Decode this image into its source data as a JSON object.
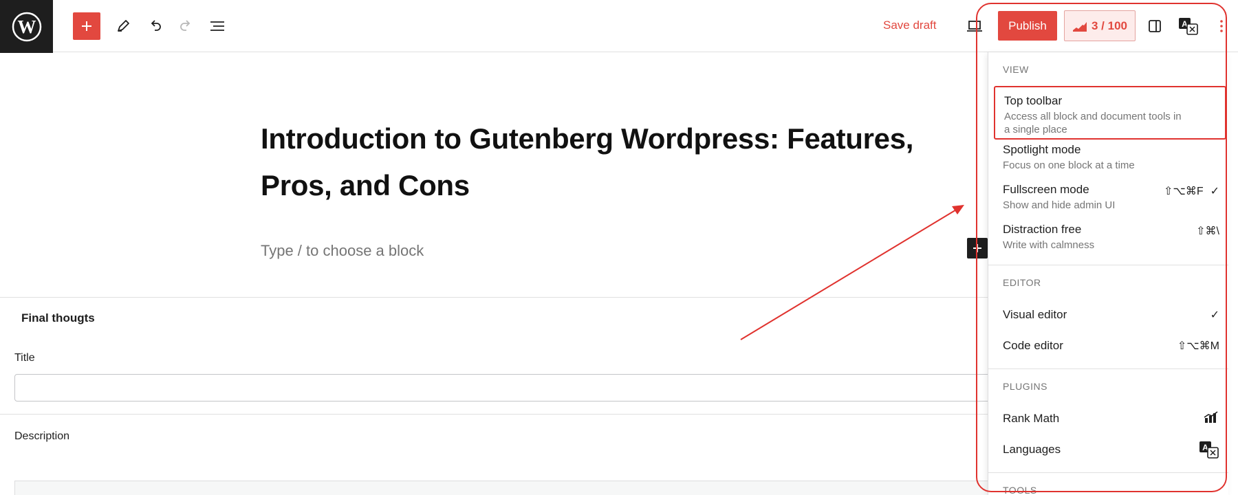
{
  "header": {
    "save_draft": "Save draft",
    "publish": "Publish",
    "seo_score": "3 / 100"
  },
  "editor": {
    "post_title": "Introduction to Gutenberg Wordpress: Features, Pros, and Cons",
    "block_placeholder": "Type / to choose a block"
  },
  "meta_box": {
    "heading": "Final thougts",
    "title_label": "Title",
    "description_label": "Description"
  },
  "menu": {
    "view_title": "VIEW",
    "top_toolbar_label": "Top toolbar",
    "top_toolbar_desc": "Access all block and document tools in a single place",
    "spotlight_label": "Spotlight mode",
    "spotlight_desc": "Focus on one block at a time",
    "fullscreen_label": "Fullscreen mode",
    "fullscreen_desc": "Show and hide admin UI",
    "fullscreen_shortcut": "⇧⌥⌘F",
    "distraction_label": "Distraction free",
    "distraction_desc": "Write with calmness",
    "distraction_shortcut": "⇧⌘\\",
    "editor_title": "EDITOR",
    "visual_editor": "Visual editor",
    "code_editor": "Code editor",
    "code_editor_shortcut": "⇧⌥⌘M",
    "plugins_title": "PLUGINS",
    "rank_math": "Rank Math",
    "languages": "Languages",
    "tools_title": "TOOLS",
    "checkmark": "✓"
  },
  "colors": {
    "accent": "#e2483f",
    "annotation": "#e0322e",
    "dark": "#1e1e1e"
  },
  "icons": [
    "wordpress-logo-icon",
    "plus-icon",
    "pencil-icon",
    "undo-icon",
    "redo-icon",
    "list-view-icon",
    "preview-icon",
    "rank-math-icon",
    "sidebar-icon",
    "languages-icon",
    "more-vertical-icon",
    "check-icon"
  ]
}
